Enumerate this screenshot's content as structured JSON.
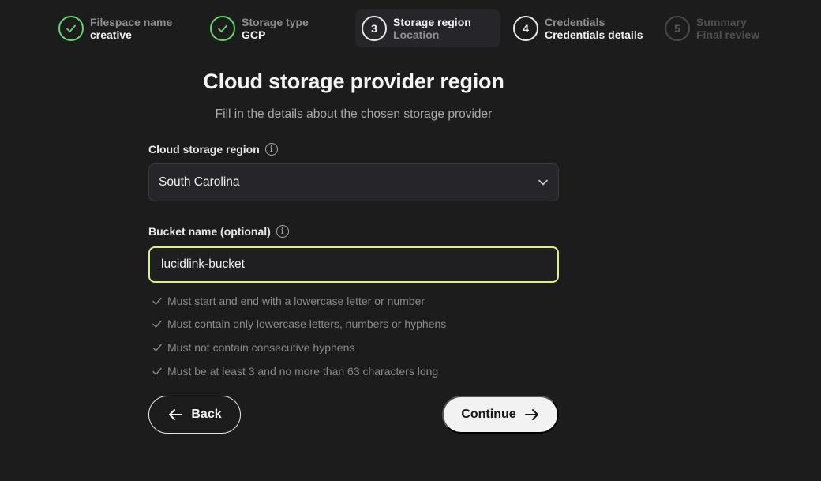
{
  "stepper": {
    "steps": [
      {
        "number": "",
        "title": "Filespace name",
        "subtitle": "creative",
        "state": "done"
      },
      {
        "number": "",
        "title": "Storage type",
        "subtitle": "GCP",
        "state": "done"
      },
      {
        "number": "3",
        "title": "Storage region",
        "subtitle": "Location",
        "state": "active"
      },
      {
        "number": "4",
        "title": "Credentials",
        "subtitle": "Credentials details",
        "state": "upcoming"
      },
      {
        "number": "5",
        "title": "Summary",
        "subtitle": "Final review",
        "state": "disabled"
      }
    ]
  },
  "page": {
    "title": "Cloud storage provider region",
    "subtitle": "Fill in the details about the chosen storage provider"
  },
  "region": {
    "label": "Cloud storage region",
    "value": "South Carolina"
  },
  "bucket": {
    "label": "Bucket name (optional)",
    "value": "lucidlink-bucket",
    "rules": [
      "Must start and end with a lowercase letter or number",
      "Must contain only lowercase letters, numbers or hyphens",
      "Must not contain consecutive hyphens",
      "Must be at least 3 and no more than 63 characters long"
    ]
  },
  "actions": {
    "back_label": "Back",
    "continue_label": "Continue"
  },
  "colors": {
    "background": "#1c1c1d",
    "success": "#63d66a",
    "input_focus": "#d8f090"
  }
}
